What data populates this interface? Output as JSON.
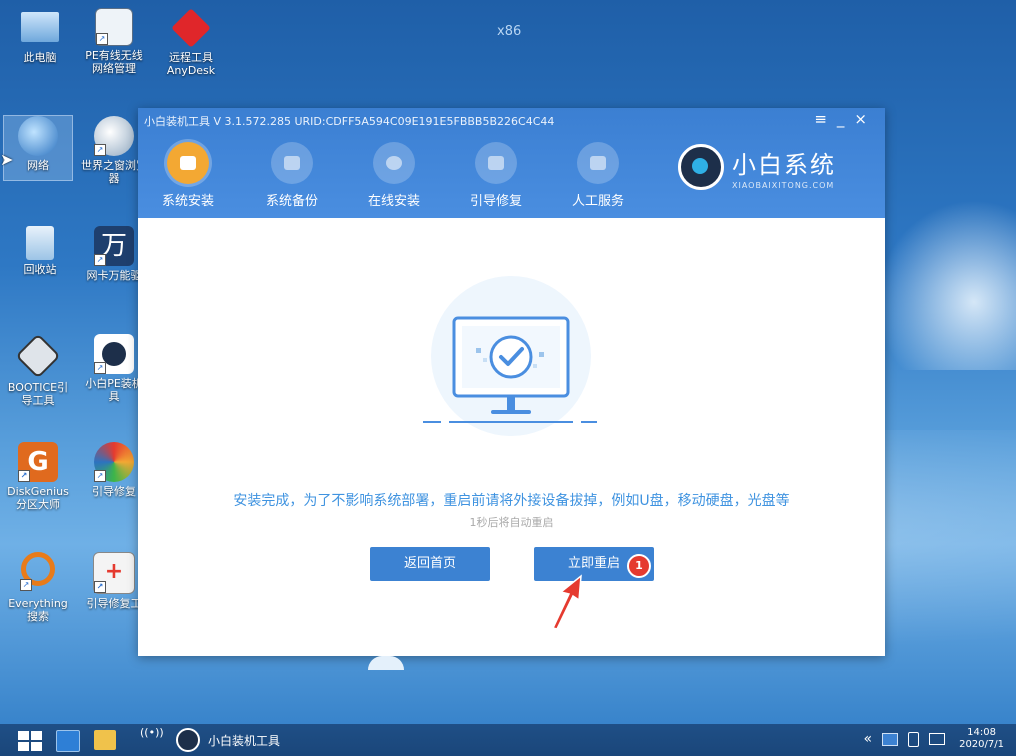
{
  "desktop": {
    "arch_label": "x86",
    "icons": [
      {
        "label": "此电脑"
      },
      {
        "label": "PE有线无线网络管理"
      },
      {
        "label": "远程工具AnyDesk"
      },
      {
        "label": "网络"
      },
      {
        "label": "世界之窗浏览器"
      },
      {
        "label": "回收站"
      },
      {
        "label": "网卡万能驱"
      },
      {
        "label": "BOOTICE引导工具"
      },
      {
        "label": "小白PE装机具"
      },
      {
        "label": "DiskGenius分区大师"
      },
      {
        "label": "引导修复"
      },
      {
        "label": "Everything搜索"
      },
      {
        "label": "引导修复工"
      }
    ]
  },
  "window": {
    "title": "小白装机工具 V 3.1.572.285 URID:CDFF5A594C09E191E5FBBB5B226C4C44",
    "controls": {
      "menu": "≡",
      "minimize": "_",
      "close": "×"
    },
    "nav": [
      {
        "label": "系统安装",
        "active": true
      },
      {
        "label": "系统备份",
        "active": false
      },
      {
        "label": "在线安装",
        "active": false
      },
      {
        "label": "引导修复",
        "active": false
      },
      {
        "label": "人工服务",
        "active": false
      }
    ],
    "brand": {
      "name": "小白系统",
      "sub": "XIAOBAIXITONG.COM"
    },
    "message": "安装完成，为了不影响系统部署，重启前请将外接设备拔掉，例如U盘，移动硬盘，光盘等",
    "countdown": "1秒后将自动重启",
    "buttons": {
      "back": "返回首页",
      "restart": "立即重启"
    },
    "badge": "1"
  },
  "taskbar": {
    "app_label": "小白装机工具",
    "tray_chevron": "«",
    "time": "14:08",
    "date": "2020/7/1"
  },
  "colors": {
    "accent": "#3c82d2",
    "nav_active": "#f3a833",
    "message": "#3f93e0",
    "badge": "#e53a2f"
  }
}
